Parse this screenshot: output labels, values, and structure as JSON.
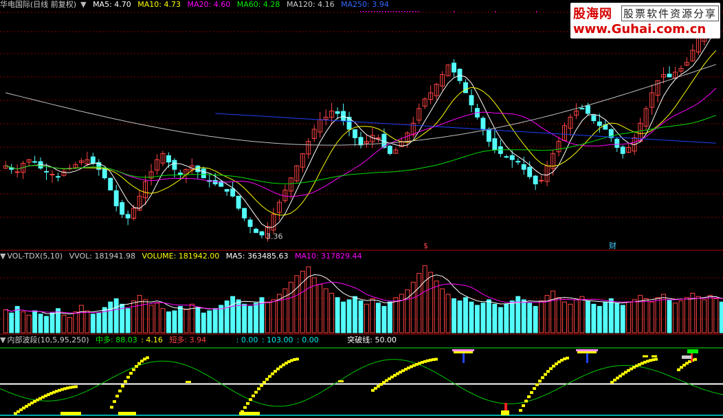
{
  "main_header": {
    "title": "华电国际(日线 前复权)",
    "ma5": "MA5: 4.70",
    "ma10": "MA10: 4.73",
    "ma20": "MA20: 4.60",
    "ma60": "MA60: 4.28",
    "ma120": "MA120: 4.16",
    "ma250": "MA250: 3.94"
  },
  "vol_header": {
    "title": "VOL-TDX(5,10)",
    "vvol": "VVOL: 181941.98",
    "volume": "VOLUME: 181942.00",
    "ma5": "MA5: 363485.63",
    "ma10": "MA10: 317829.44"
  },
  "ind_header": {
    "title": "内部波段(10,5,95,250)",
    "zhongduo": "中多: 88.03",
    "v2": ": 4.16",
    "duanduo": "短多: 3.94",
    "v4": ": 0.00",
    "v5": ": 103.00",
    "v6": ": 0.00",
    "tupo": "突破线: 50.00"
  },
  "annotations": {
    "low_label": "3.36",
    "marker1": "$",
    "marker2": "财"
  },
  "watermark": {
    "line1": "股海网",
    "line1b": "股票软件资源分享",
    "line2": "www.Guhai.com.cn"
  },
  "colors": {
    "up": "#ff4444",
    "down": "#54fcfc",
    "ma5": "#ffffff",
    "ma10": "#ffff00",
    "ma20": "#ff00ff",
    "ma60": "#00e000",
    "ma120": "#c0c0c0",
    "ma250": "#2040ff",
    "grid": "#8b0000",
    "signal": "#ffff00"
  },
  "chart_data": [
    {
      "type": "candlestick",
      "title": "华电国际(日线 前复权)",
      "ylim": [
        3.3,
        5.2
      ],
      "annotated_low": 3.36,
      "series": [
        {
          "name": "MA5",
          "value": 4.7
        },
        {
          "name": "MA10",
          "value": 4.73
        },
        {
          "name": "MA20",
          "value": 4.6
        },
        {
          "name": "MA60",
          "value": 4.28
        },
        {
          "name": "MA120",
          "value": 4.16
        },
        {
          "name": "MA250",
          "value": 3.94
        }
      ],
      "close": [
        3.95,
        3.92,
        3.9,
        3.97,
        4.0,
        3.98,
        3.93,
        3.9,
        3.88,
        3.86,
        3.9,
        3.93,
        3.96,
        3.99,
        4.0,
        3.97,
        3.92,
        3.85,
        3.75,
        3.62,
        3.55,
        3.52,
        3.6,
        3.7,
        3.82,
        3.9,
        4.0,
        4.05,
        3.98,
        3.92,
        3.88,
        3.92,
        3.95,
        3.9,
        3.85,
        3.82,
        3.8,
        3.78,
        3.74,
        3.7,
        3.6,
        3.52,
        3.45,
        3.4,
        3.38,
        3.45,
        3.55,
        3.65,
        3.75,
        3.85,
        3.95,
        4.05,
        4.15,
        4.25,
        4.33,
        4.35,
        4.4,
        4.38,
        4.32,
        4.25,
        4.18,
        4.12,
        4.15,
        4.2,
        4.18,
        4.1,
        4.05,
        4.08,
        4.15,
        4.22,
        4.3,
        4.42,
        4.5,
        4.55,
        4.62,
        4.7,
        4.78,
        4.72,
        4.65,
        4.55,
        4.45,
        4.35,
        4.25,
        4.15,
        4.08,
        4.05,
        4.02,
        4.0,
        3.98,
        3.92,
        3.86,
        3.8,
        3.83,
        3.95,
        4.05,
        4.15,
        4.28,
        4.35,
        4.4,
        4.42,
        4.38,
        4.32,
        4.28,
        4.25,
        4.18,
        4.1,
        4.05,
        4.1,
        4.18,
        4.3,
        4.42,
        4.55,
        4.65,
        4.7,
        4.68,
        4.72,
        4.75,
        4.8,
        4.9,
        5.0,
        5.1,
        5.15,
        5.18
      ]
    },
    {
      "type": "bar",
      "title": "VOL-TDX(5,10)",
      "series": [
        {
          "name": "VVOL",
          "value": 181941.98
        },
        {
          "name": "VOLUME",
          "value": 181942.0
        },
        {
          "name": "MA5",
          "value": 363485.63
        },
        {
          "name": "MA10",
          "value": 317829.44
        }
      ],
      "values": [
        2.1,
        1.8,
        2.4,
        1.9,
        1.6,
        2.0,
        1.7,
        1.5,
        1.8,
        2.2,
        1.6,
        1.4,
        1.9,
        2.5,
        2.0,
        1.7,
        1.8,
        2.3,
        2.8,
        3.1,
        2.6,
        2.2,
        2.9,
        3.4,
        3.0,
        2.5,
        2.7,
        2.2,
        1.9,
        2.0,
        2.4,
        2.1,
        2.6,
        2.3,
        1.8,
        2.0,
        2.2,
        2.5,
        2.9,
        3.3,
        3.0,
        2.6,
        2.4,
        2.7,
        3.2,
        2.8,
        3.0,
        3.5,
        4.0,
        4.6,
        5.2,
        5.6,
        6.0,
        5.0,
        4.4,
        4.0,
        3.6,
        3.2,
        2.8,
        3.0,
        3.3,
        2.9,
        2.6,
        3.1,
        2.7,
        2.4,
        2.8,
        3.2,
        3.5,
        3.9,
        4.6,
        5.4,
        6.1,
        5.5,
        4.7,
        4.0,
        3.5,
        3.1,
        2.9,
        3.2,
        2.8,
        2.5,
        2.7,
        3.0,
        2.6,
        2.3,
        2.6,
        2.9,
        3.3,
        3.0,
        2.7,
        2.4,
        2.9,
        3.4,
        3.8,
        3.2,
        2.8,
        2.6,
        3.0,
        3.3,
        2.9,
        2.6,
        2.4,
        2.8,
        3.1,
        2.7,
        2.5,
        2.8,
        3.0,
        3.4,
        3.1,
        2.8,
        3.2,
        3.5,
        3.0,
        2.7,
        2.9,
        3.2,
        3.6,
        3.3,
        3.0,
        3.4,
        3.1,
        2.8,
        3.2
      ]
    },
    {
      "type": "step",
      "title": "内部波段(10,5,95,250)",
      "series": [
        {
          "name": "中多",
          "value": 88.03
        },
        {
          "name": "短多",
          "value": 3.94
        },
        {
          "name": "突破线",
          "value": 50.0
        }
      ],
      "ylim": [
        0,
        110
      ]
    }
  ]
}
